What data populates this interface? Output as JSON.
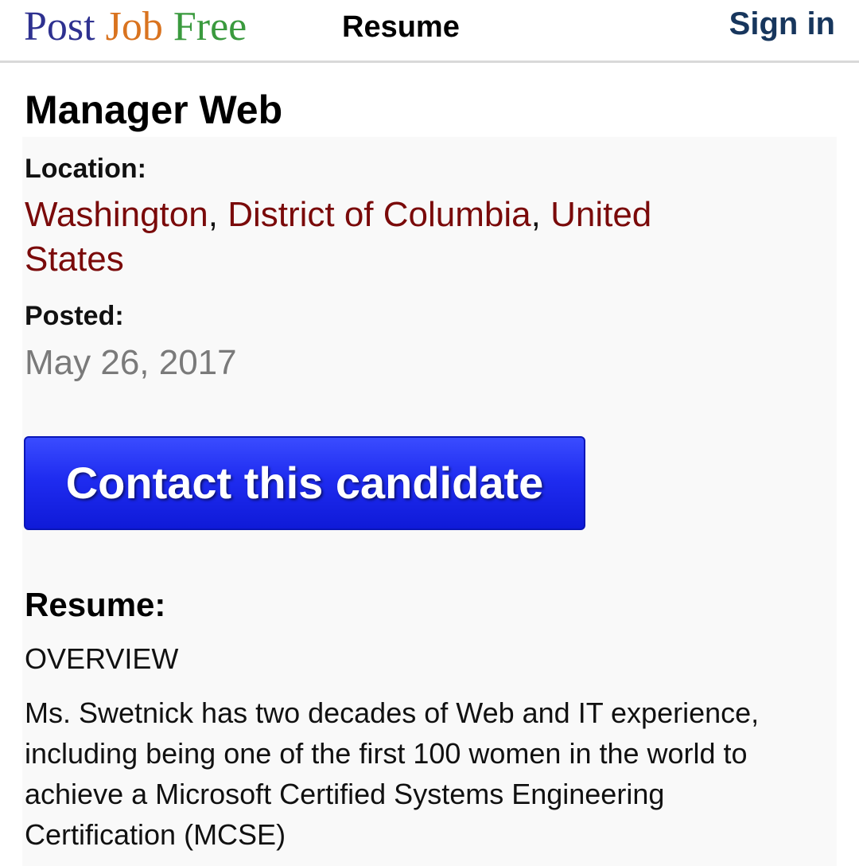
{
  "header": {
    "logo": {
      "word1": "Post",
      "word2": "Job",
      "word3": "Free"
    },
    "nav_resume": "Resume",
    "sign_in": "Sign in"
  },
  "job": {
    "title": "Manager Web",
    "location_label": "Location:",
    "location": {
      "city": "Washington",
      "separator1": ", ",
      "state": "District of Columbia",
      "separator2": ", ",
      "country": "United States"
    },
    "posted_label": "Posted:",
    "posted_date": "May 26, 2017"
  },
  "contact_button": "Contact this candidate",
  "resume": {
    "heading": "Resume:",
    "section": "OVERVIEW",
    "body": "Ms. Swetnick has two decades of Web and IT experience, including being one of the first 100 women in the world to achieve a Microsoft Certified Systems Engineering Certification (MCSE)"
  },
  "colors": {
    "logo_post": "#2e3190",
    "logo_job": "#d9731f",
    "logo_free": "#3a9a3e",
    "sign_in": "#17365d",
    "location_link": "#7a0a0a",
    "button": "#1f2cf0"
  }
}
